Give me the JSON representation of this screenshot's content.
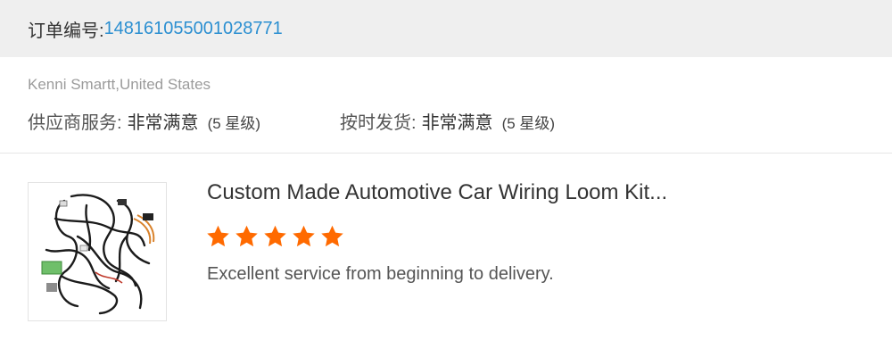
{
  "order": {
    "label": "订单编号:",
    "number": "148161055001028771"
  },
  "buyer": {
    "name_country": "Kenni Smartt,United States"
  },
  "ratings": {
    "supplier": {
      "label": "供应商服务:",
      "value": "非常满意",
      "level": "(5 星级)"
    },
    "delivery": {
      "label": "按时发货:",
      "value": "非常满意",
      "level": "(5 星级)"
    }
  },
  "product": {
    "title": "Custom Made Automotive Car Wiring Loom Kit...",
    "thumbnail_icon": "wiring-harness-image",
    "stars_filled": 5,
    "stars_total": 5,
    "review": "Excellent service from beginning to delivery."
  },
  "colors": {
    "order_number": "#2b8fd1",
    "star": "#ff6a00",
    "header_bg": "#efefef"
  }
}
